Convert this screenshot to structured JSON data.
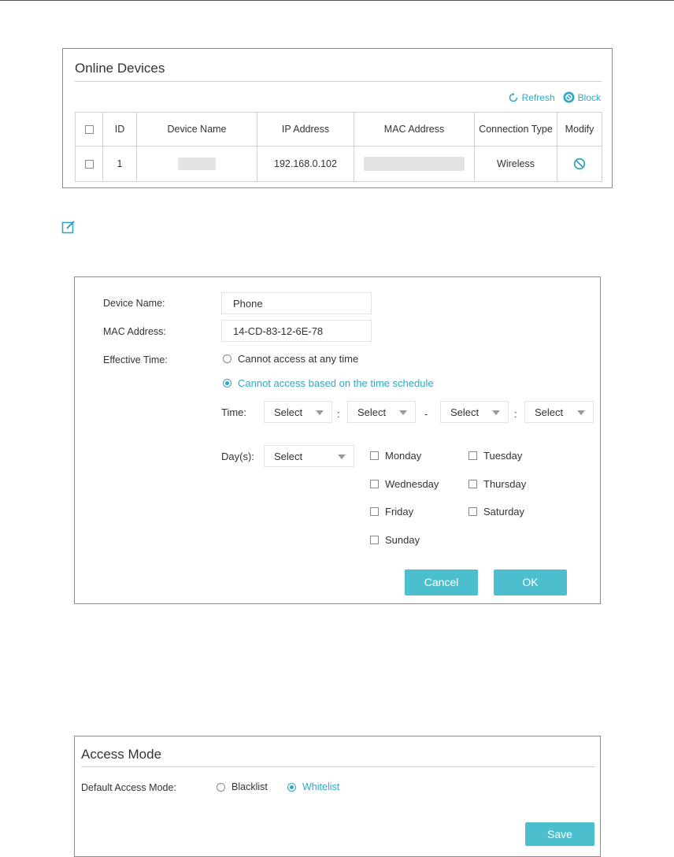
{
  "online_devices": {
    "title": "Online Devices",
    "refresh_label": "Refresh",
    "block_label": "Block",
    "columns": [
      "ID",
      "Device Name",
      "IP Address",
      "MAC Address",
      "Connection Type",
      "Modify"
    ],
    "rows": [
      {
        "id": "1",
        "ip": "192.168.0.102",
        "connection": "Wireless"
      }
    ]
  },
  "modify_dialog": {
    "device_name_label": "Device Name:",
    "device_name_value": "Phone",
    "mac_label": "MAC Address:",
    "mac_value": "14-CD-83-12-6E-78",
    "effective_time_label": "Effective Time:",
    "option_any_time": "Cannot access at any time",
    "option_schedule": "Cannot access based on the time schedule",
    "selected_option": "schedule",
    "time_label": "Time:",
    "time_selects": [
      "Select",
      "Select",
      "Select",
      "Select"
    ],
    "time_sep_colon": ":",
    "time_sep_dash": "-",
    "days_label": "Day(s):",
    "days_select": "Select",
    "days": [
      "Monday",
      "Tuesday",
      "Wednesday",
      "Thursday",
      "Friday",
      "Saturday",
      "Sunday"
    ],
    "cancel_label": "Cancel",
    "ok_label": "OK"
  },
  "access_mode": {
    "title": "Access Mode",
    "default_label": "Default Access Mode:",
    "option_blacklist": "Blacklist",
    "option_whitelist": "Whitelist",
    "selected": "Whitelist",
    "save_label": "Save"
  },
  "colors": {
    "accent": "#2fa9c2",
    "button": "#4cbfcf",
    "border": "#8a8a8a"
  }
}
